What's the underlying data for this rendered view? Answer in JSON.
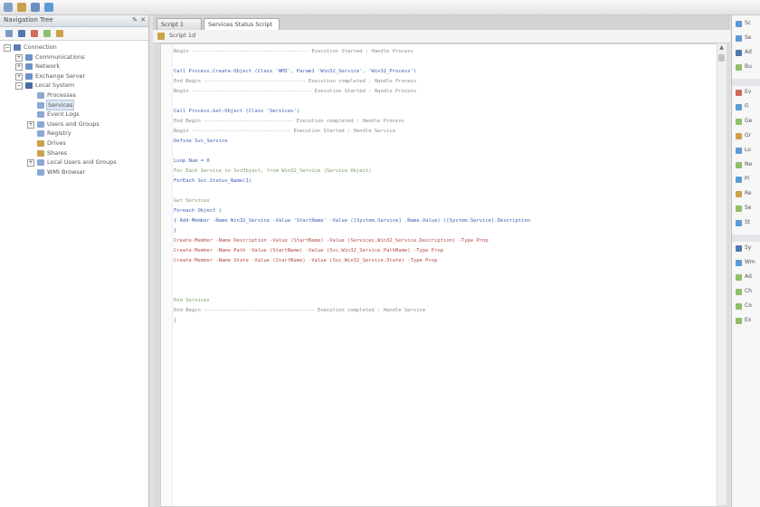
{
  "toolbar": {
    "buttons": [
      {
        "icon": "new-document-icon",
        "color": "#7fa0c8"
      },
      {
        "icon": "open-folder-icon",
        "color": "#c9a24a"
      },
      {
        "icon": "database-icon",
        "color": "#6a8fbf"
      },
      {
        "icon": "run-icon",
        "color": "#5b9bd5"
      }
    ]
  },
  "navigation": {
    "title": "Navigation Tree",
    "pin_glyph": "✎",
    "close_glyph": "✕",
    "tools": [
      {
        "icon": "back-icon",
        "color": "#7a9bc7"
      },
      {
        "icon": "connect-icon",
        "color": "#4f78b0"
      },
      {
        "icon": "delete-icon",
        "color": "#d06a5a"
      },
      {
        "icon": "refresh-icon",
        "color": "#8fbf6a"
      },
      {
        "icon": "properties-icon",
        "color": "#c9a24a"
      }
    ],
    "tree": [
      {
        "label": "Connection",
        "depth": 0,
        "expander": "−",
        "icon_color": "#5f7fae"
      },
      {
        "label": "Communications",
        "depth": 1,
        "expander": "+",
        "icon_color": "#6e92c6"
      },
      {
        "label": "Network",
        "depth": 1,
        "expander": "+",
        "icon_color": "#6e92c6"
      },
      {
        "label": "Exchange Server",
        "depth": 1,
        "expander": "+",
        "icon_color": "#6e92c6"
      },
      {
        "label": "Local System",
        "depth": 1,
        "expander": "−",
        "icon_color": "#4a6aa0"
      },
      {
        "label": "Processes",
        "depth": 2,
        "expander": "",
        "icon_color": "#8ca9d3"
      },
      {
        "label": "Services",
        "depth": 2,
        "expander": "",
        "icon_color": "#8ca9d3",
        "selected": true
      },
      {
        "label": "Event Logs",
        "depth": 2,
        "expander": "",
        "icon_color": "#8ca9d3"
      },
      {
        "label": "Users and Groups",
        "depth": 2,
        "expander": "+",
        "icon_color": "#8ca9d3"
      },
      {
        "label": "Registry",
        "depth": 2,
        "expander": "",
        "icon_color": "#8ca9d3"
      },
      {
        "label": "Drives",
        "depth": 2,
        "expander": "",
        "icon_color": "#c9a24a"
      },
      {
        "label": "Shares",
        "depth": 2,
        "expander": "",
        "icon_color": "#c9a24a"
      },
      {
        "label": "Local Users and Groups",
        "depth": 2,
        "expander": "+",
        "icon_color": "#8ca9d3"
      },
      {
        "label": "WMI Browser",
        "depth": 2,
        "expander": "",
        "icon_color": "#8ca9d3"
      }
    ]
  },
  "editor": {
    "tabs": [
      {
        "label": "Script 1",
        "active": false
      },
      {
        "label": "Services Status Script",
        "active": true
      }
    ],
    "tab_close_glyph": "✕",
    "subbar_label": "Script 1d",
    "lines": [
      {
        "text": "Begin --------------------------------------- Execution Started : Handle Process",
        "cls": "dash"
      },
      {
        "text": "",
        "cls": ""
      },
      {
        "text": "Call Process.Create-Object (Class 'WMI', Param1 'Win32_Service', 'Win32_Process')",
        "cls": "kw"
      },
      {
        "text": "End Begin ---------------------------------- Execution completed : Handle Process",
        "cls": "dash"
      },
      {
        "text": "Begin ---------------------------------------- Execution Started : Handle Process",
        "cls": "dash"
      },
      {
        "text": "",
        "cls": ""
      },
      {
        "text": "Call Process.Get-Object (Class 'Services')",
        "cls": "kw"
      },
      {
        "text": "End Begin ------------------------------ Execution completed : Handle Process",
        "cls": "dash"
      },
      {
        "text": "Begin --------------------------------- Execution Started : Handle Service",
        "cls": "dash"
      },
      {
        "text": "Define Svc_Service",
        "cls": "kw"
      },
      {
        "text": "",
        "cls": ""
      },
      {
        "text": "Loop Num = 0",
        "cls": "kw"
      },
      {
        "text": "For Each Service in SvcObject, from Win32_Service (Service Object)",
        "cls": "cmt"
      },
      {
        "text": "  ForEach Svc.Status_Name(1)",
        "cls": "kw"
      },
      {
        "text": "",
        "cls": ""
      },
      {
        "text": "Get Services",
        "cls": "cmt"
      },
      {
        "text": "  Foreach Object (",
        "cls": "kw"
      },
      {
        "text": "    {  Add-Member -Name Win32_Service -Value 'StartName' -Value ([System.Service] .Name.Value) ([System.Service].Description",
        "cls": "kw"
      },
      {
        "text": "  }",
        "cls": "kw"
      },
      {
        "text": "  Create-Member -Name Description -Value (StartName) -Value (Services.Win32_Service.Description) -Type Prop",
        "cls": "str"
      },
      {
        "text": "  Create-Member -Name Path -Value (StartName) -Value (Svc.Win32_Service.PathName) -Type Prop",
        "cls": "str"
      },
      {
        "text": "  Create-Member -Name State -Value (StartName) -Value (Svc.Win32_Service.State) -Type Prop",
        "cls": "str"
      },
      {
        "text": "",
        "cls": ""
      },
      {
        "text": "",
        "cls": ""
      },
      {
        "text": "",
        "cls": ""
      },
      {
        "text": "End Services",
        "cls": "cmt"
      },
      {
        "text": "End Begin ------------------------------------- Execution completed : Handle Service",
        "cls": "dash"
      },
      {
        "text": "|",
        "cls": "kw"
      }
    ]
  },
  "toolbox": {
    "items": [
      {
        "label": "Sc",
        "color": "#5b9bd5"
      },
      {
        "label": "Se",
        "color": "#5b9bd5"
      },
      {
        "label": "Ad",
        "color": "#4f78b0"
      },
      {
        "label": "Bu",
        "color": "#8fbf6a"
      },
      {
        "label": "Ev",
        "color": "#d06a5a"
      },
      {
        "label": "Fi",
        "color": "#5b9bd5"
      },
      {
        "label": "Ge",
        "color": "#8fbf6a"
      },
      {
        "label": "Gr",
        "color": "#c9a24a"
      },
      {
        "label": "Lo",
        "color": "#5b9bd5"
      },
      {
        "label": "Ne",
        "color": "#8fbf6a"
      },
      {
        "label": "Pi",
        "color": "#5b9bd5"
      },
      {
        "label": "Re",
        "color": "#c9a24a"
      },
      {
        "label": "Se",
        "color": "#8fbf6a"
      },
      {
        "label": "St",
        "color": "#5b9bd5"
      },
      {
        "label": "Sy",
        "color": "#4f78b0"
      },
      {
        "label": "Wm",
        "color": "#5b9bd5"
      },
      {
        "label": "Ad",
        "color": "#8fbf6a"
      },
      {
        "label": "Ch",
        "color": "#8fbf6a"
      },
      {
        "label": "Co",
        "color": "#8fbf6a"
      },
      {
        "label": "Ex",
        "color": "#8fbf6a"
      }
    ]
  }
}
